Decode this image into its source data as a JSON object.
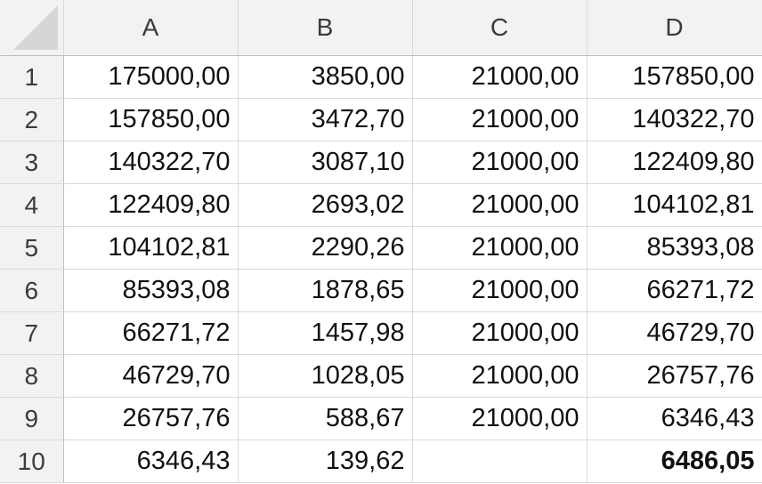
{
  "columns": [
    "A",
    "B",
    "C",
    "D"
  ],
  "rows": [
    {
      "num": "1",
      "A": "175000,00",
      "B": "3850,00",
      "C": "21000,00",
      "D": "157850,00"
    },
    {
      "num": "2",
      "A": "157850,00",
      "B": "3472,70",
      "C": "21000,00",
      "D": "140322,70"
    },
    {
      "num": "3",
      "A": "140322,70",
      "B": "3087,10",
      "C": "21000,00",
      "D": "122409,80"
    },
    {
      "num": "4",
      "A": "122409,80",
      "B": "2693,02",
      "C": "21000,00",
      "D": "104102,81"
    },
    {
      "num": "5",
      "A": "104102,81",
      "B": "2290,26",
      "C": "21000,00",
      "D": "85393,08"
    },
    {
      "num": "6",
      "A": "85393,08",
      "B": "1878,65",
      "C": "21000,00",
      "D": "66271,72"
    },
    {
      "num": "7",
      "A": "66271,72",
      "B": "1457,98",
      "C": "21000,00",
      "D": "46729,70"
    },
    {
      "num": "8",
      "A": "46729,70",
      "B": "1028,05",
      "C": "21000,00",
      "D": "26757,76"
    },
    {
      "num": "9",
      "A": "26757,76",
      "B": "588,67",
      "C": "21000,00",
      "D": "6346,43"
    },
    {
      "num": "10",
      "A": "6346,43",
      "B": "139,62",
      "C": "",
      "D": "6486,05"
    }
  ],
  "bold_cells": [
    "D10"
  ]
}
